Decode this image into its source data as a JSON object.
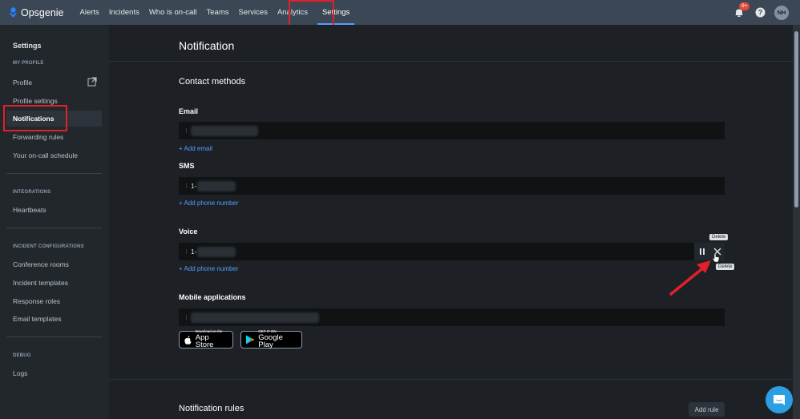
{
  "app": {
    "name": "Opsgenie"
  },
  "nav": {
    "items": [
      "Alerts",
      "Incidents",
      "Who is on-call",
      "Teams",
      "Services",
      "Analytics",
      "Settings"
    ],
    "active": "Settings",
    "notifications_badge": "9+",
    "avatar_initials": "NH"
  },
  "sidebar": {
    "title": "Settings",
    "sections": {
      "my_profile": "MY PROFILE",
      "integrations": "INTEGRATIONS",
      "incident_configurations": "INCIDENT CONFIGURATIONS",
      "debug": "DEBUG"
    },
    "items": {
      "profile": "Profile",
      "profile_settings": "Profile settings",
      "notifications": "Notifications",
      "forwarding_rules": "Forwarding rules",
      "oncall_schedule": "Your on-call schedule",
      "heartbeats": "Heartbeats",
      "conference_rooms": "Conference rooms",
      "incident_templates": "Incident templates",
      "response_roles": "Response roles",
      "email_templates": "Email templates",
      "logs": "Logs"
    }
  },
  "main": {
    "title": "Notification",
    "contact_methods": "Contact methods",
    "email_label": "Email",
    "add_email": "+ Add email",
    "sms_label": "SMS",
    "sms_prefix": "1-",
    "add_phone_sms": "+ Add phone number",
    "voice_label": "Voice",
    "voice_prefix": "1-",
    "add_phone_voice": "+ Add phone number",
    "delete_tooltip": "Delete",
    "mobile_label": "Mobile applications",
    "app_store_small": "Download on the",
    "app_store_big": "App Store",
    "google_play_small": "GET IT ON",
    "google_play_big": "Google Play",
    "notification_rules": "Notification rules",
    "add_rule": "Add rule"
  },
  "colors": {
    "accent": "#579dff",
    "highlight": "#e2202a",
    "arrow": "#e2202a"
  }
}
